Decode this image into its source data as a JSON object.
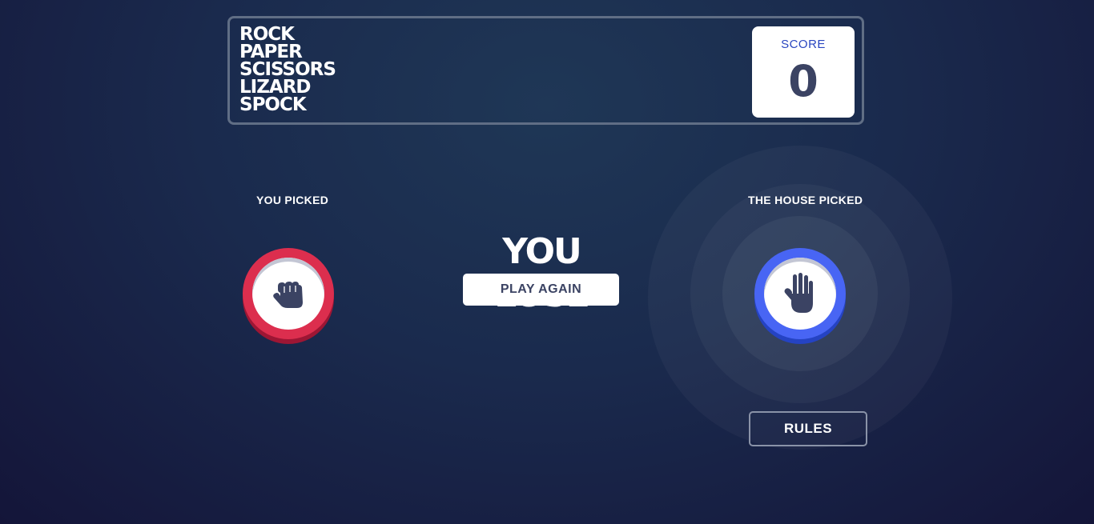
{
  "header": {
    "title_lines": [
      "ROCK",
      "PAPER",
      "SCISSORS",
      "LIZARD",
      "SPOCK"
    ],
    "score_label": "SCORE",
    "score_value": "0"
  },
  "game": {
    "you_picked_label": "YOU PICKED",
    "house_picked_label": "THE HOUSE PICKED",
    "player_choice": "rock",
    "house_choice": "paper",
    "result_text": "YOU LOSE",
    "play_again_label": "PLAY AGAIN"
  },
  "footer": {
    "rules_label": "RULES"
  },
  "colors": {
    "rock": "#dc2e4e",
    "paper": "#4865f4",
    "score_label": "#2a46c0",
    "dark_text": "#3b4363"
  },
  "icons": {
    "player_icon": "fist-icon",
    "house_icon": "open-hand-icon"
  }
}
